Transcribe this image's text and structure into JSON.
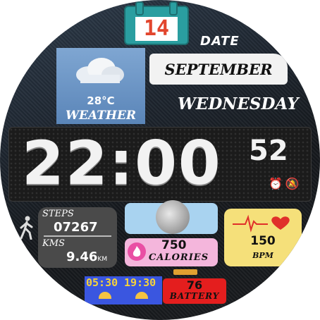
{
  "calendar": {
    "day": "14"
  },
  "date": {
    "label": "DATE",
    "month": "SEPTEMBER",
    "weekday": "WEDNESDAY"
  },
  "weather": {
    "temperature": "28°C",
    "label": "WEATHER",
    "icon": "cloud-icon"
  },
  "time": {
    "hours_minutes": "22:00",
    "seconds": "52"
  },
  "alarms": {
    "icons": [
      "alarm-icon",
      "alarm-off-icon"
    ],
    "glyphs": "⏰🔕"
  },
  "steps": {
    "label": "STEPS",
    "value": "07267",
    "distance_label": "KMS",
    "distance": "9.46",
    "distance_unit": "KM",
    "icon": "walking-person-icon"
  },
  "moon": {
    "icon": "moon-phase-icon"
  },
  "calories": {
    "value": "750",
    "label": "CALORIES",
    "icon": "flame-icon"
  },
  "heart_rate": {
    "value": "150",
    "label": "BPM",
    "icon": "heart-pulse-icon"
  },
  "sun": {
    "sunrise": "05:30",
    "sunset": "19:30",
    "icons": [
      "sunrise-icon",
      "sunset-icon"
    ]
  },
  "battery": {
    "value": "76",
    "label": "BATTERY",
    "icon": "battery-icon"
  },
  "colors": {
    "accent_teal": "#2a9ea0",
    "calendar_red": "#e2462e",
    "weather_blue": "#6a94c6",
    "calories_pink": "#f4b6dc",
    "hr_yellow": "#f5e07a",
    "battery_red": "#e41e1e",
    "sun_blue": "#3a56e0"
  }
}
